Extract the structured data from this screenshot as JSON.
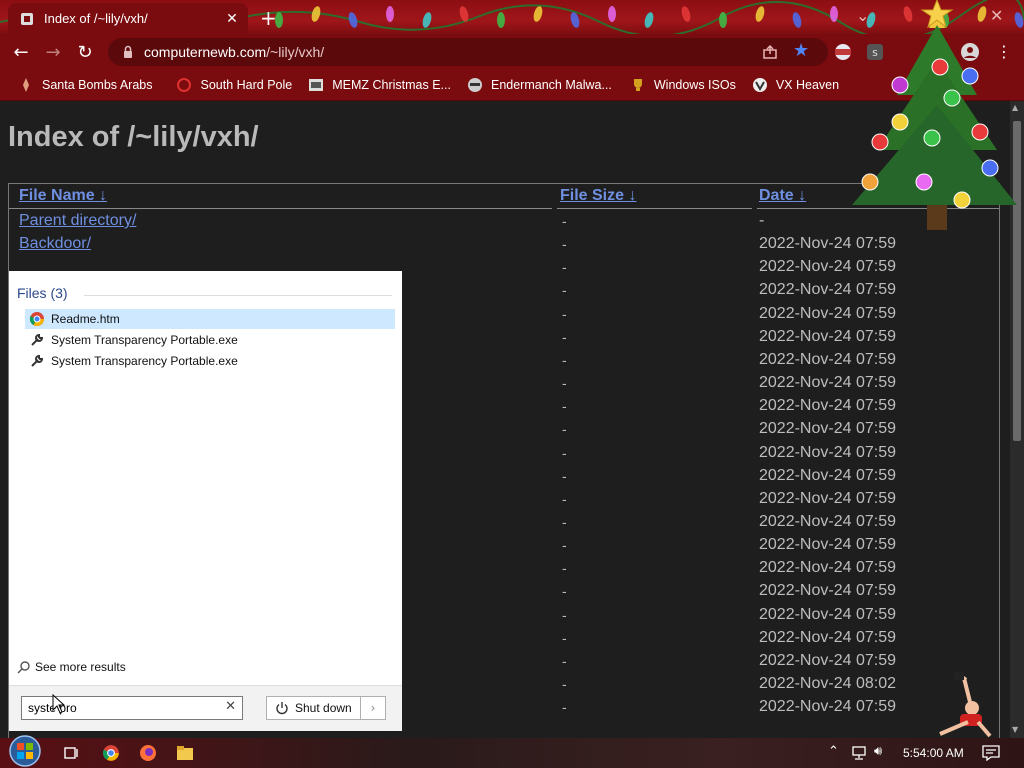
{
  "browser": {
    "tab_title": "Index of /~lily/vxh/",
    "url_host": "computernewb.com",
    "url_path": "/~lily/vxh/",
    "bookmarks": [
      {
        "label": "Santa Bombs Arabs",
        "icon": "santa-icon"
      },
      {
        "label": "South Hard Pole",
        "icon": "snowflake-icon"
      },
      {
        "label": "MEMZ Christmas E...",
        "icon": "memz-icon"
      },
      {
        "label": "Endermanch Malwa...",
        "icon": "raccoon-icon"
      },
      {
        "label": "Windows ISOs",
        "icon": "trophy-icon"
      },
      {
        "label": "VX Heaven",
        "icon": "vx-icon"
      }
    ]
  },
  "page": {
    "heading": "Index of /~lily/vxh/",
    "columns": {
      "name": "File Name",
      "size": "File Size",
      "date": "Date",
      "sort_arrow": "↓"
    },
    "rows": [
      {
        "name": "Parent directory/",
        "size": "-",
        "date": "-"
      },
      {
        "name": "Backdoor/",
        "size": "-",
        "date": "2022-Nov-24 07:59"
      },
      {
        "name": "",
        "size": "-",
        "date": "2022-Nov-24 07:59"
      },
      {
        "name": "",
        "size": "-",
        "date": "2022-Nov-24 07:59"
      },
      {
        "name": "",
        "size": "-",
        "date": "2022-Nov-24 07:59"
      },
      {
        "name": "",
        "size": "-",
        "date": "2022-Nov-24 07:59"
      },
      {
        "name": "",
        "size": "-",
        "date": "2022-Nov-24 07:59"
      },
      {
        "name": "",
        "size": "-",
        "date": "2022-Nov-24 07:59"
      },
      {
        "name": "",
        "size": "-",
        "date": "2022-Nov-24 07:59"
      },
      {
        "name": "",
        "size": "-",
        "date": "2022-Nov-24 07:59"
      },
      {
        "name": "",
        "size": "-",
        "date": "2022-Nov-24 07:59"
      },
      {
        "name": "",
        "size": "-",
        "date": "2022-Nov-24 07:59"
      },
      {
        "name": "",
        "size": "-",
        "date": "2022-Nov-24 07:59"
      },
      {
        "name": "",
        "size": "-",
        "date": "2022-Nov-24 07:59"
      },
      {
        "name": "",
        "size": "-",
        "date": "2022-Nov-24 07:59"
      },
      {
        "name": "",
        "size": "-",
        "date": "2022-Nov-24 07:59"
      },
      {
        "name": "",
        "size": "-",
        "date": "2022-Nov-24 07:59"
      },
      {
        "name": "",
        "size": "-",
        "date": "2022-Nov-24 07:59"
      },
      {
        "name": "",
        "size": "-",
        "date": "2022-Nov-24 07:59"
      },
      {
        "name": "",
        "size": "-",
        "date": "2022-Nov-24 07:59"
      },
      {
        "name": "",
        "size": "-",
        "date": "2022-Nov-24 08:02"
      },
      {
        "name": "",
        "size": "-",
        "date": "2022-Nov-24 07:59"
      }
    ]
  },
  "search_panel": {
    "section_label": "Files (3)",
    "results": [
      {
        "label": "Readme.htm",
        "icon": "chrome-icon"
      },
      {
        "label": "System Transparency Portable.exe",
        "icon": "wrench-icon"
      },
      {
        "label": "System Transparency Portable.exe",
        "icon": "wrench-icon"
      }
    ],
    "see_more": "See more results",
    "query": "syste pro",
    "shutdown_label": "Shut down"
  },
  "taskbar": {
    "time": "5:54:00 AM"
  },
  "colors": {
    "chrome_red": "#7a0c0f",
    "link_blue": "#6f8fe0",
    "page_bg": "#1e1e1e"
  }
}
